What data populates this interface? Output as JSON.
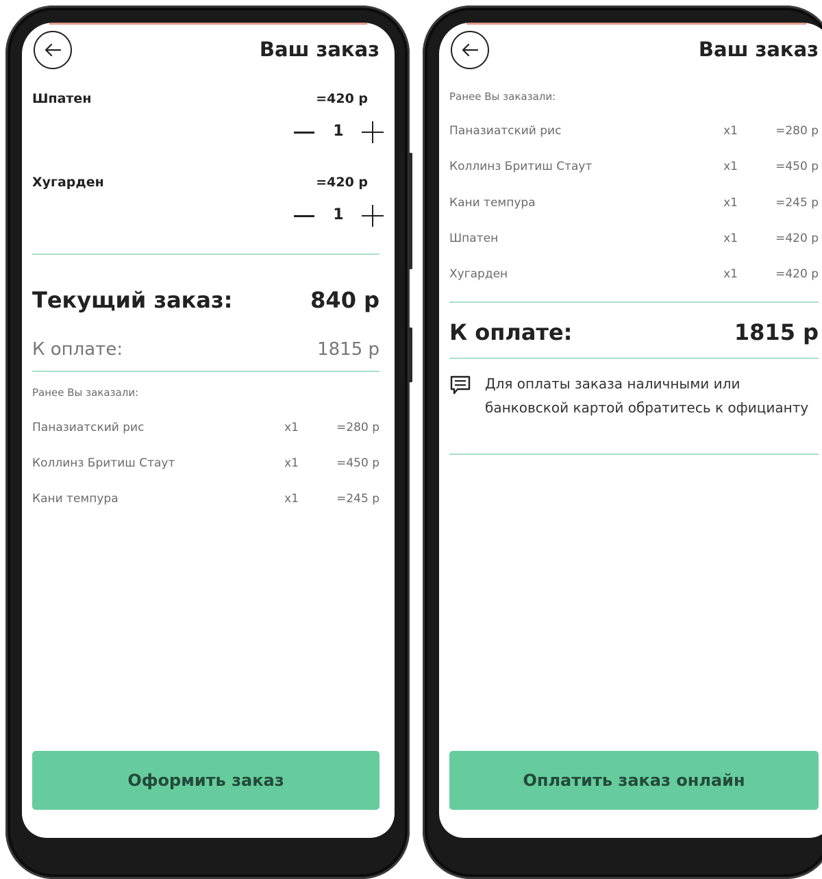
{
  "left_screen": {
    "title": "Ваш заказ",
    "cart_items": [
      {
        "name": "Шпатен",
        "price": "=420 р",
        "quantity": "1"
      },
      {
        "name": "Хугарден",
        "price": "=420 р",
        "quantity": "1"
      }
    ],
    "current_order_label": "Текущий заказ:",
    "current_order_total": "840 р",
    "to_pay_label": "К оплате:",
    "to_pay_total": "1815 р",
    "previous_caption": "Ранее Вы заказали:",
    "previous_items": [
      {
        "name": "Паназиатский рис",
        "qty": "x1",
        "price": "=280 р"
      },
      {
        "name": "Коллинз Бритиш Стаут",
        "qty": "x1",
        "price": "=450 р"
      },
      {
        "name": "Кани темпура",
        "qty": "x1",
        "price": "=245 р"
      }
    ],
    "action_label": "Оформить заказ"
  },
  "right_screen": {
    "title": "Ваш заказ",
    "previous_caption": "Ранее Вы заказали:",
    "previous_items": [
      {
        "name": "Паназиатский рис",
        "qty": "x1",
        "price": "=280 р"
      },
      {
        "name": "Коллинз Бритиш Стаут",
        "qty": "x1",
        "price": "=450 р"
      },
      {
        "name": "Кани темпура",
        "qty": "x1",
        "price": "=245 р"
      },
      {
        "name": "Шпатен",
        "qty": "x1",
        "price": "=420 р"
      },
      {
        "name": "Хугарден",
        "qty": "x1",
        "price": "=420 р"
      }
    ],
    "to_pay_label": "К оплате:",
    "to_pay_total": "1815 р",
    "payment_note": "Для оплаты заказа наличными или банковской картой обратитесь к официанту",
    "action_label": "Оплатить заказ онлайн"
  },
  "icons": {
    "back": "arrow-left-icon",
    "note": "message-icon",
    "minus": "minus-icon",
    "plus": "plus-icon"
  },
  "colors": {
    "accent": "#66cc9e",
    "divider": "#a8dfc9",
    "button_text": "#234a3a",
    "phone_frame": "#1a1a1a"
  }
}
